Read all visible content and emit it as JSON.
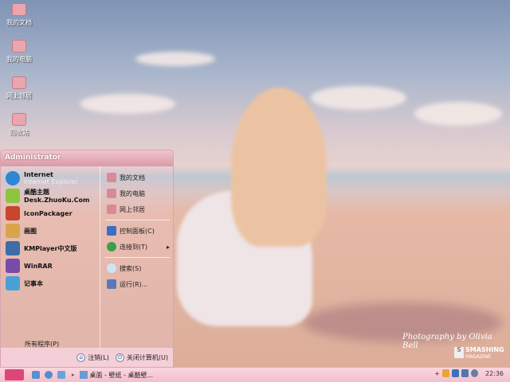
{
  "desktop_icons": [
    {
      "label": "我的文档"
    },
    {
      "label": "我的电脑"
    },
    {
      "label": "网上邻居"
    },
    {
      "label": "回收站"
    }
  ],
  "wallpaper": {
    "credit": "Photography by Olivia Bell",
    "logo_main": "SMASHING",
    "logo_sub": "MAGAZINE"
  },
  "start_menu": {
    "user": "Administrator",
    "left_items": [
      {
        "label": "Internet",
        "sub": "Internet Explorer",
        "color": "#2f86d6"
      },
      {
        "label": "桌酷主题",
        "sub": "Desk.ZhuoKu.Com",
        "color": "#8cc63f"
      },
      {
        "label": "IconPackager",
        "color": "#c8452e"
      },
      {
        "label": "画图",
        "color": "#d9a44a"
      },
      {
        "label": "KMPlayer中文版",
        "color": "#3d6ea8"
      },
      {
        "label": "WinRAR",
        "color": "#7a4aa8"
      },
      {
        "label": "记事本",
        "color": "#4aa0d8"
      }
    ],
    "all_programs": "所有程序(P)",
    "right_items": [
      {
        "label": "我的文档"
      },
      {
        "label": "我的电脑"
      },
      {
        "label": "网上邻居"
      },
      {
        "label": "控制面板(C)"
      },
      {
        "label": "连接到(T)",
        "arrow": "▸"
      },
      {
        "label": "搜索(S)"
      },
      {
        "label": "运行(R)..."
      }
    ],
    "logoff": "注销(L)",
    "shutdown": "关闭计算机(U)"
  },
  "taskbar": {
    "start_icon": "apple-icon",
    "task_label": "桌面 - 壁纸 - 桌酷壁...",
    "arrow": "▸",
    "clock": "22:36",
    "tray_plus": "+"
  }
}
